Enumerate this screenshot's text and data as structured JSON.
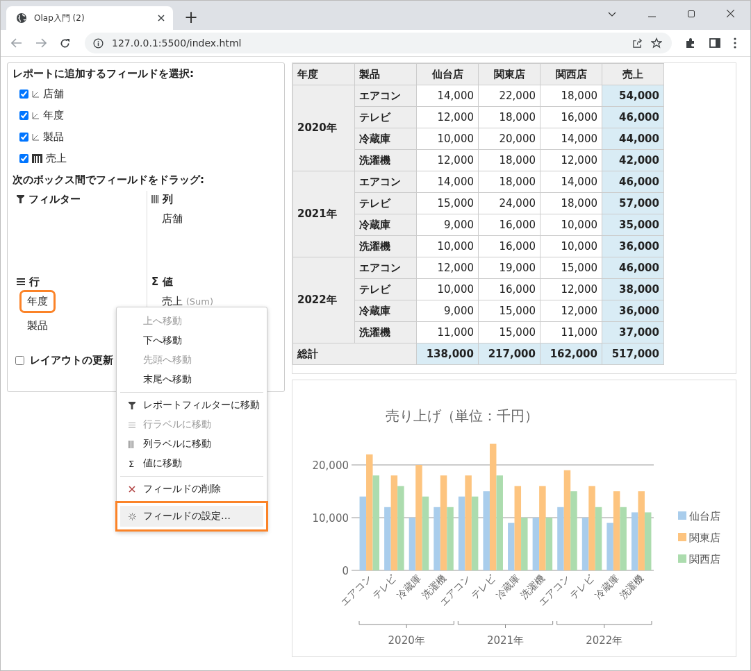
{
  "browser": {
    "tab": {
      "title": "Olap入門 (2)",
      "selected": true
    },
    "new_tab": "+",
    "url": "127.0.0.1:5500/index.html"
  },
  "field_panel": {
    "title": "レポートに追加するフィールドを選択:",
    "fields": [
      {
        "label": "店舗",
        "checked": true,
        "kind": "dimension"
      },
      {
        "label": "年度",
        "checked": true,
        "kind": "dimension"
      },
      {
        "label": "製品",
        "checked": true,
        "kind": "dimension"
      },
      {
        "label": "売上",
        "checked": true,
        "kind": "measure"
      }
    ],
    "drag_title": "次のボックス間でフィールドをドラッグ:",
    "boxes": [
      {
        "title": "フィルター",
        "kind": "filter"
      },
      {
        "title": "列",
        "kind": "columns",
        "items": [
          {
            "label": "店舗",
            "highlighted": false
          }
        ]
      },
      {
        "title": "行",
        "kind": "rows",
        "items": [
          {
            "label": "年度",
            "highlighted": true
          },
          {
            "label": "製品",
            "highlighted": false
          }
        ]
      },
      {
        "title": "値",
        "kind": "values",
        "symbol": "Σ",
        "items": [
          {
            "label": "売上",
            "note": "(Sum)",
            "highlighted": false
          }
        ]
      }
    ],
    "defer_update": {
      "label": "レイアウトの更新",
      "checked": false
    }
  },
  "context_menu": [
    {
      "kind": "item",
      "label": "上へ移動",
      "disabled": true,
      "highlighted": false
    },
    {
      "kind": "item",
      "label": "下へ移動",
      "disabled": false,
      "highlighted": false
    },
    {
      "kind": "item",
      "label": "先頭へ移動",
      "disabled": true,
      "highlighted": false
    },
    {
      "kind": "item",
      "label": "末尾へ移動",
      "disabled": false,
      "highlighted": false
    },
    {
      "kind": "separator"
    },
    {
      "kind": "filter",
      "label": "レポートフィルターに移動",
      "disabled": false,
      "highlighted": false
    },
    {
      "kind": "rows",
      "label": "行ラベルに移動",
      "disabled": true,
      "highlighted": false
    },
    {
      "kind": "columns",
      "label": "列ラベルに移動",
      "disabled": false,
      "highlighted": false
    },
    {
      "kind": "values",
      "label": "値に移動",
      "symbol": "Σ",
      "disabled": false,
      "highlighted": false
    },
    {
      "kind": "separator"
    },
    {
      "kind": "delete",
      "label": "フィールドの削除",
      "disabled": false,
      "highlighted": false
    },
    {
      "kind": "settings",
      "label": "フィールドの設定…",
      "disabled": false,
      "highlighted": true
    }
  ],
  "pivot_table": {
    "columns": [
      "年度",
      "製品",
      "仙台店",
      "関東店",
      "関西店",
      "売上"
    ],
    "groups": [
      {
        "year": "2020年",
        "rows": [
          {
            "product": "エアコン",
            "values": [
              "14,000",
              "22,000",
              "18,000"
            ],
            "total": "54,000"
          },
          {
            "product": "テレビ",
            "values": [
              "12,000",
              "18,000",
              "16,000"
            ],
            "total": "46,000"
          },
          {
            "product": "冷蔵庫",
            "values": [
              "10,000",
              "20,000",
              "14,000"
            ],
            "total": "44,000"
          },
          {
            "product": "洗濯機",
            "values": [
              "12,000",
              "18,000",
              "12,000"
            ],
            "total": "42,000"
          }
        ]
      },
      {
        "year": "2021年",
        "rows": [
          {
            "product": "エアコン",
            "values": [
              "14,000",
              "18,000",
              "14,000"
            ],
            "total": "46,000"
          },
          {
            "product": "テレビ",
            "values": [
              "15,000",
              "24,000",
              "18,000"
            ],
            "total": "57,000"
          },
          {
            "product": "冷蔵庫",
            "values": [
              "9,000",
              "16,000",
              "10,000"
            ],
            "total": "35,000"
          },
          {
            "product": "洗濯機",
            "values": [
              "10,000",
              "16,000",
              "10,000"
            ],
            "total": "36,000"
          }
        ]
      },
      {
        "year": "2022年",
        "rows": [
          {
            "product": "エアコン",
            "values": [
              "12,000",
              "19,000",
              "15,000"
            ],
            "total": "46,000"
          },
          {
            "product": "テレビ",
            "values": [
              "10,000",
              "16,000",
              "12,000"
            ],
            "total": "38,000"
          },
          {
            "product": "冷蔵庫",
            "values": [
              "9,000",
              "15,000",
              "12,000"
            ],
            "total": "36,000"
          },
          {
            "product": "洗濯機",
            "values": [
              "11,000",
              "15,000",
              "11,000"
            ],
            "total": "37,000"
          }
        ]
      }
    ],
    "grand_total": {
      "label": "総計",
      "values": [
        "138,000",
        "217,000",
        "162,000"
      ],
      "total": "517,000"
    }
  },
  "chart": {
    "chart_data": {
      "type": "bar",
      "title": "売り上げ（単位：千円）",
      "categories": [
        "エアコン",
        "テレビ",
        "冷蔵庫",
        "洗濯機",
        "エアコン",
        "テレビ",
        "冷蔵庫",
        "洗濯機",
        "エアコン",
        "テレビ",
        "冷蔵庫",
        "洗濯機"
      ],
      "annotations": [
        {
          "text": "2020年"
        },
        {
          "text": "2021年"
        },
        {
          "text": "2022年"
        }
      ],
      "legend": "right",
      "ylim": [
        0,
        24000
      ],
      "series": [
        {
          "name": "仙台店",
          "color": "#a9cdec",
          "values": [
            14000,
            12000,
            10000,
            12000,
            14000,
            15000,
            9000,
            10000,
            12000,
            10000,
            9000,
            11000
          ]
        },
        {
          "name": "関東店",
          "color": "#fdc47f",
          "values": [
            22000,
            18000,
            20000,
            18000,
            18000,
            24000,
            16000,
            16000,
            19000,
            16000,
            15000,
            15000
          ]
        },
        {
          "name": "関西店",
          "color": "#acdcae",
          "values": [
            18000,
            16000,
            14000,
            12000,
            14000,
            18000,
            10000,
            10000,
            15000,
            12000,
            12000,
            11000
          ]
        }
      ],
      "yticks": [
        {
          "value": 0,
          "label": "0"
        },
        {
          "value": 10000,
          "label": "10,000"
        },
        {
          "value": 20000,
          "label": "20,000"
        }
      ]
    }
  }
}
